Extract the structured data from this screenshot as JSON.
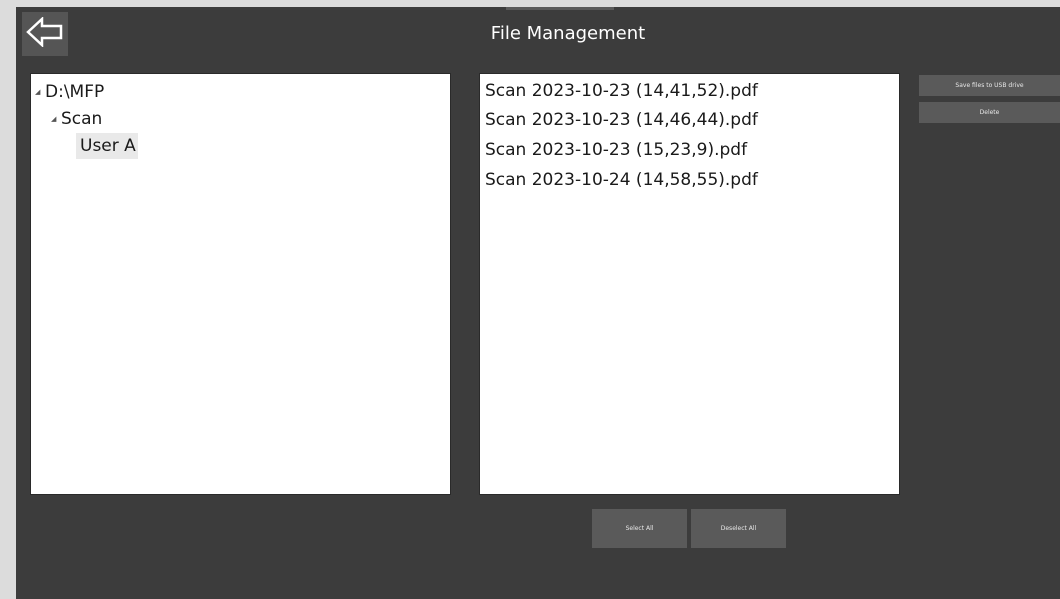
{
  "header": {
    "title": "File Management",
    "back_icon": "back-arrow-icon"
  },
  "tree": {
    "items": [
      {
        "label": "D:\\MFP",
        "level": 0,
        "expanded": true
      },
      {
        "label": "Scan",
        "level": 1,
        "expanded": true
      },
      {
        "label": "User A",
        "level": 2,
        "selected": true
      }
    ]
  },
  "files": {
    "items": [
      "Scan 2023-10-23 (14,41,52).pdf",
      "Scan 2023-10-23 (14,46,44).pdf",
      "Scan 2023-10-23 (15,23,9).pdf",
      "Scan 2023-10-24 (14,58,55).pdf"
    ]
  },
  "actions": {
    "save_to_usb_label": "Save files to USB drive",
    "delete_label": "Delete",
    "select_all_label": "Select All",
    "deselect_all_label": "Deselect All"
  },
  "colors": {
    "background": "#3c3c3c",
    "button": "#5a5a5a",
    "panel": "#ffffff"
  }
}
